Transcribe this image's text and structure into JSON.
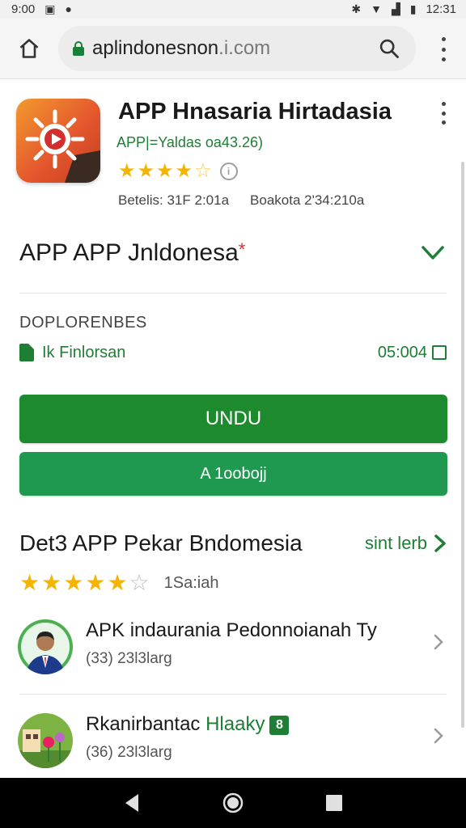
{
  "status_bar": {
    "left_text": "9:00",
    "time": "12:31"
  },
  "browser": {
    "url_main": "apl",
    "url_rest": "indonesnon",
    "url_tail": ".i.com",
    "icons": [
      "home-icon",
      "lock-icon",
      "search-icon",
      "more-vert-icon"
    ]
  },
  "app": {
    "title": "APP Hnasaria Hirtadasia",
    "developer": "APP|=Yaldas oa43.26)",
    "rating_stars": 4.5,
    "info_glyph": "i",
    "meta_left": "Betelis: 31F 2:01a",
    "meta_right": "Boakota   2'34:210a"
  },
  "section": {
    "title": "APP APP Jnldonesa",
    "asterisk": "*"
  },
  "downloads": {
    "label": "DOPLORENBES",
    "link_text": "Ik Finlorsan",
    "size": "05:004"
  },
  "buttons": {
    "primary": "UNDU",
    "secondary": "A 1oobojj"
  },
  "more_apps": {
    "title": "Det3 APP Pekar Bndomesia",
    "see_all": "sint lerb",
    "rating_stars": 5,
    "rating_text": "1Sa:iah"
  },
  "list": [
    {
      "title": "APK indaurania Pedonnoianah Ty",
      "subtitle": "(33) 23l3larg"
    },
    {
      "title_a": "Rkanirbantac",
      "title_b": "Hlaaky",
      "badge": "8",
      "subtitle": "(36) 23l3larg"
    }
  ],
  "colors": {
    "brand_green": "#1e8a2e",
    "secondary_green": "#1f9950",
    "star": "#f4b400"
  }
}
